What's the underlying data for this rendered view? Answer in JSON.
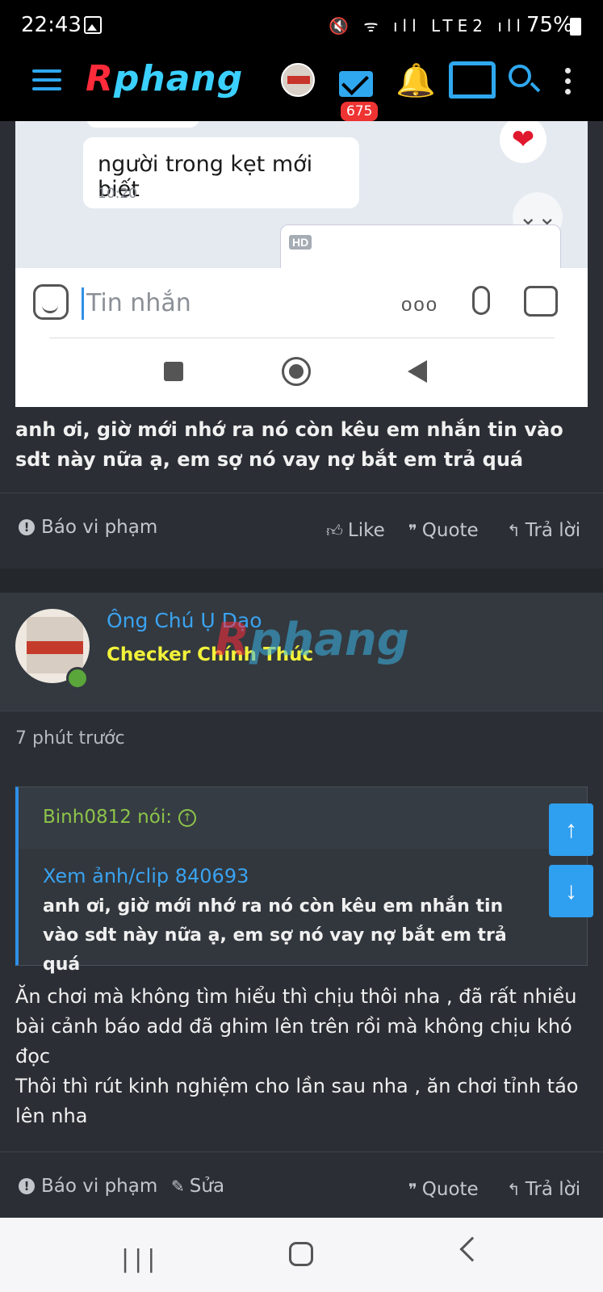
{
  "status_bar": {
    "time": "22:43",
    "icons": "🔇 ᯤ ıll LTE2 ıll",
    "battery": "75%"
  },
  "header": {
    "logo_r": "R",
    "logo_rest": "phang",
    "mail_badge": "675",
    "accent_color": "#2fa8f0"
  },
  "embedded_screenshot": {
    "message": "người trong kẹt mới biết",
    "message_time": "10:20",
    "thumb_badge": "HD",
    "heart": "❤",
    "scroll_down": "⌄⌄",
    "input_placeholder": "Tin nhắn",
    "more": "ooo"
  },
  "post1": {
    "text": "anh ơi, giờ mới nhớ ra nó còn kêu em nhắn tin vào sdt này nữa ạ, em sợ nó vay nợ bắt em trả quá",
    "report_label": "Báo vi phạm",
    "like_label": "Like",
    "quote_label": "Quote",
    "reply_label": "Trả lời"
  },
  "post2": {
    "username": "Ông Chú Ụ Dạo",
    "user_title": "Checker Chính Thức",
    "watermark_r": "R",
    "watermark_rest": "phang",
    "time_ago": "7 phút trước",
    "quote_author": "Binh0812 nói:",
    "quote_up": "↑",
    "quote_link": "Xem ảnh/clip 840693",
    "quote_text": "anh ơi, giờ mới nhớ ra nó còn kêu em nhắn tin vào sdt này nữa ạ, em sợ nó vay nợ bắt em trả quá",
    "text_line1": "Ăn chơi mà không tìm hiểu thì chịu thôi nha , đã rất nhiều bài cảnh báo add đã ghim lên trên rồi mà không chịu khó đọc",
    "text_line2": "Thôi thì rút kinh nghiệm cho lần sau nha , ăn chơi tỉnh táo lên nha",
    "report_label": "Báo vi phạm",
    "edit_label": "Sửa",
    "quote_label": "Quote",
    "reply_label": "Trả lời"
  },
  "fab": {
    "up": "↑",
    "down": "↓"
  },
  "android_nav": {
    "recent": "|||"
  }
}
